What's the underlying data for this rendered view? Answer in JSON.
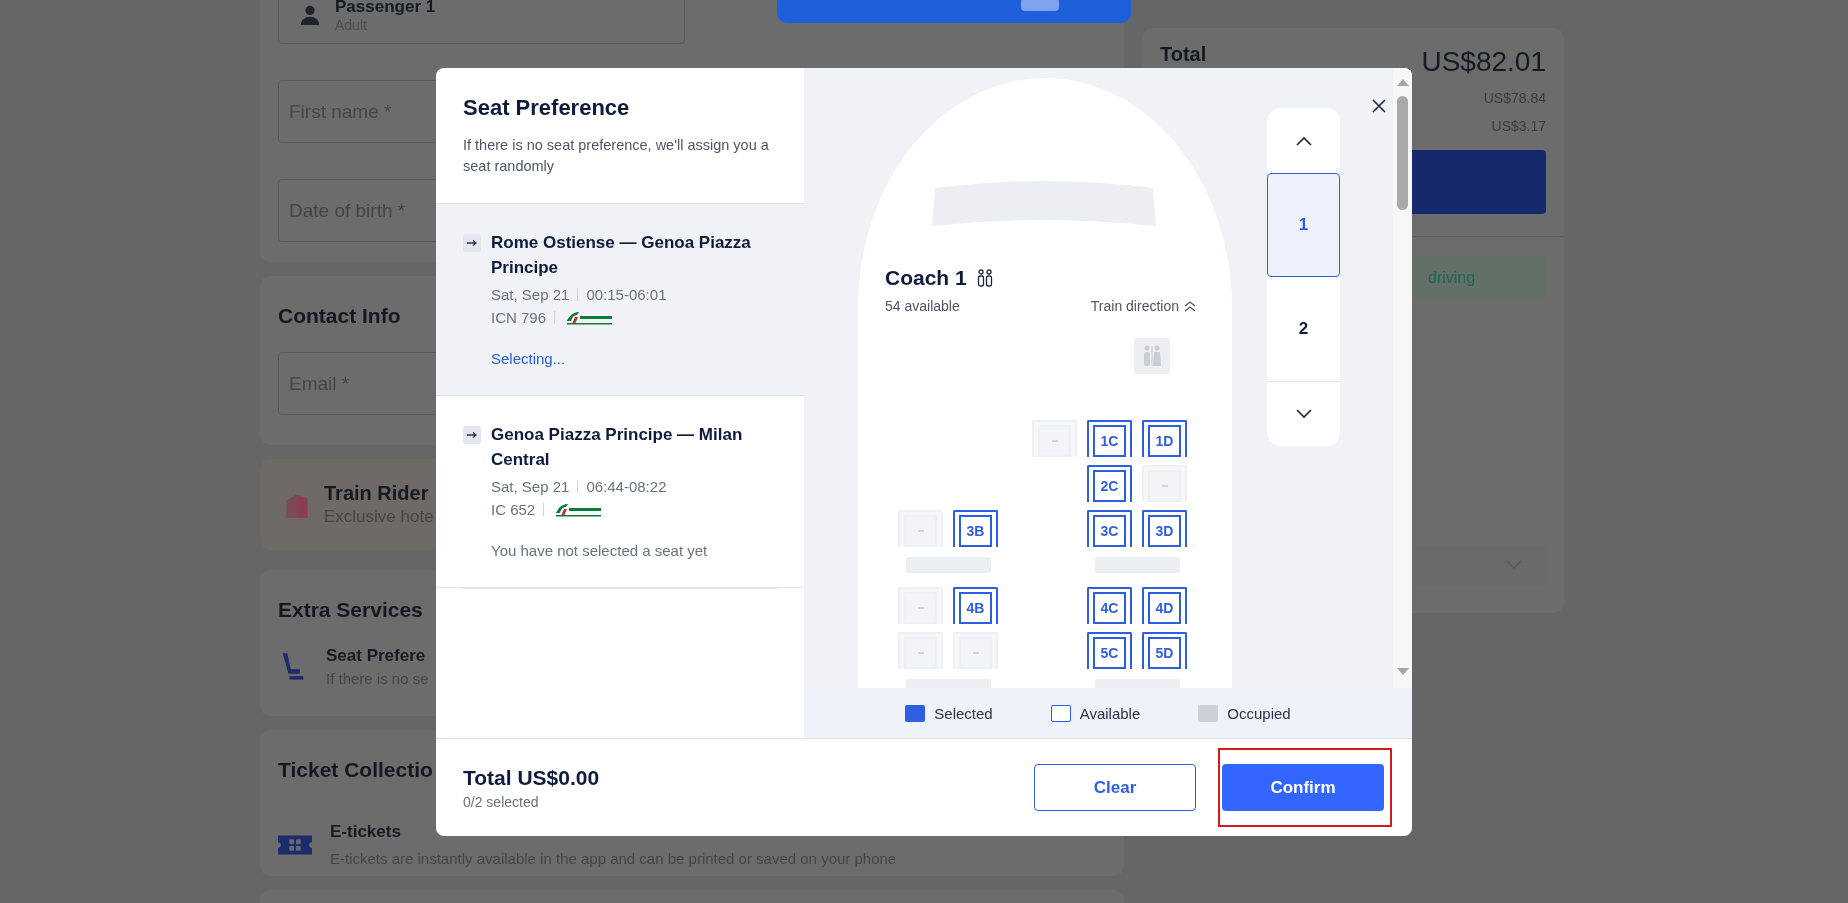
{
  "passenger": {
    "name": "Passenger 1",
    "type": "Adult",
    "fields": [
      {
        "placeholder": "First name *"
      },
      {
        "placeholder": "Date of birth *"
      }
    ]
  },
  "contact": {
    "title": "Contact Info",
    "fields": [
      {
        "placeholder": "Email *"
      }
    ]
  },
  "promo": {
    "title": "Train Rider",
    "text": "Exclusive hote"
  },
  "extra_services": {
    "title": "Extra Services",
    "items": [
      {
        "title": "Seat Prefere",
        "text": "If there is no se"
      }
    ]
  },
  "ticket_collection": {
    "title": "Ticket Collectio",
    "items": [
      {
        "title": "E-tickets",
        "text": "E-tickets are instantly available in the app and can be printed or saved on your phone"
      }
    ]
  },
  "summary": {
    "total_label": "Total",
    "total": "US$82.01",
    "lines": [
      "US$78.84",
      "US$3.17"
    ],
    "notice": "driving"
  },
  "seat_dialog": {
    "title": "Seat Preference",
    "subtitle": "If there is no seat preference, we'll assign you a seat randomly",
    "segments": [
      {
        "route": "Rome Ostiense — Genoa Piazza Principe",
        "date": "Sat, Sep 21",
        "time": "00:15-06:01",
        "train": "ICN 796",
        "status": "Selecting...",
        "selected": true
      },
      {
        "route": "Genoa Piazza Principe — Milan Central",
        "date": "Sat, Sep 21",
        "time": "06:44-08:22",
        "train": "IC 652",
        "status": "You have not selected a seat yet",
        "selected": false
      }
    ],
    "coach": {
      "name": "Coach 1",
      "available": "54 available",
      "direction": "Train direction"
    },
    "seat_rows": [
      {
        "kind": "seats",
        "seats": [
          {
            "kind": "space"
          },
          {
            "kind": "space"
          },
          {
            "kind": "seat",
            "occupied": true
          },
          {
            "kind": "seat",
            "occupied": false,
            "selected": false,
            "label": "1C"
          },
          {
            "kind": "seat",
            "occupied": false,
            "selected": false,
            "label": "1D"
          }
        ]
      },
      {
        "kind": "seats",
        "seats": [
          {
            "kind": "space"
          },
          {
            "kind": "space"
          },
          {
            "kind": "space"
          },
          {
            "kind": "seat",
            "occupied": false,
            "selected": false,
            "label": "2C"
          },
          {
            "kind": "seat",
            "occupied": true
          }
        ]
      },
      {
        "kind": "seats",
        "seats": [
          {
            "kind": "seat",
            "occupied": true
          },
          {
            "kind": "seat",
            "occupied": false,
            "selected": false,
            "label": "3B"
          },
          {
            "kind": "space"
          },
          {
            "kind": "seat",
            "occupied": false,
            "selected": false,
            "label": "3C"
          },
          {
            "kind": "seat",
            "occupied": false,
            "selected": false,
            "label": "3D"
          }
        ]
      },
      {
        "kind": "table"
      },
      {
        "kind": "seats",
        "seats": [
          {
            "kind": "seat",
            "occupied": true
          },
          {
            "kind": "seat",
            "occupied": false,
            "selected": false,
            "label": "4B"
          },
          {
            "kind": "space"
          },
          {
            "kind": "seat",
            "occupied": false,
            "selected": false,
            "label": "4C"
          },
          {
            "kind": "seat",
            "occupied": false,
            "selected": false,
            "label": "4D"
          }
        ]
      },
      {
        "kind": "seats",
        "seats": [
          {
            "kind": "seat",
            "occupied": true
          },
          {
            "kind": "seat",
            "occupied": true
          },
          {
            "kind": "space"
          },
          {
            "kind": "seat",
            "occupied": false,
            "selected": false,
            "label": "5C"
          },
          {
            "kind": "seat",
            "occupied": false,
            "selected": false,
            "label": "5D"
          }
        ]
      },
      {
        "kind": "table"
      }
    ],
    "coaches": [
      {
        "label": "1",
        "selected": true
      },
      {
        "label": "2",
        "selected": false
      }
    ],
    "legend": [
      {
        "label": "Selected",
        "kind": "selected"
      },
      {
        "label": "Available",
        "kind": "available"
      },
      {
        "label": "Occupied",
        "kind": "occupied"
      }
    ],
    "total": "Total US$0.00",
    "count": "0/2 selected",
    "buttons": [
      {
        "label": "Clear",
        "kind": "secondary",
        "highlighted": false
      },
      {
        "label": "Confirm",
        "kind": "primary",
        "highlighted": true
      }
    ]
  }
}
